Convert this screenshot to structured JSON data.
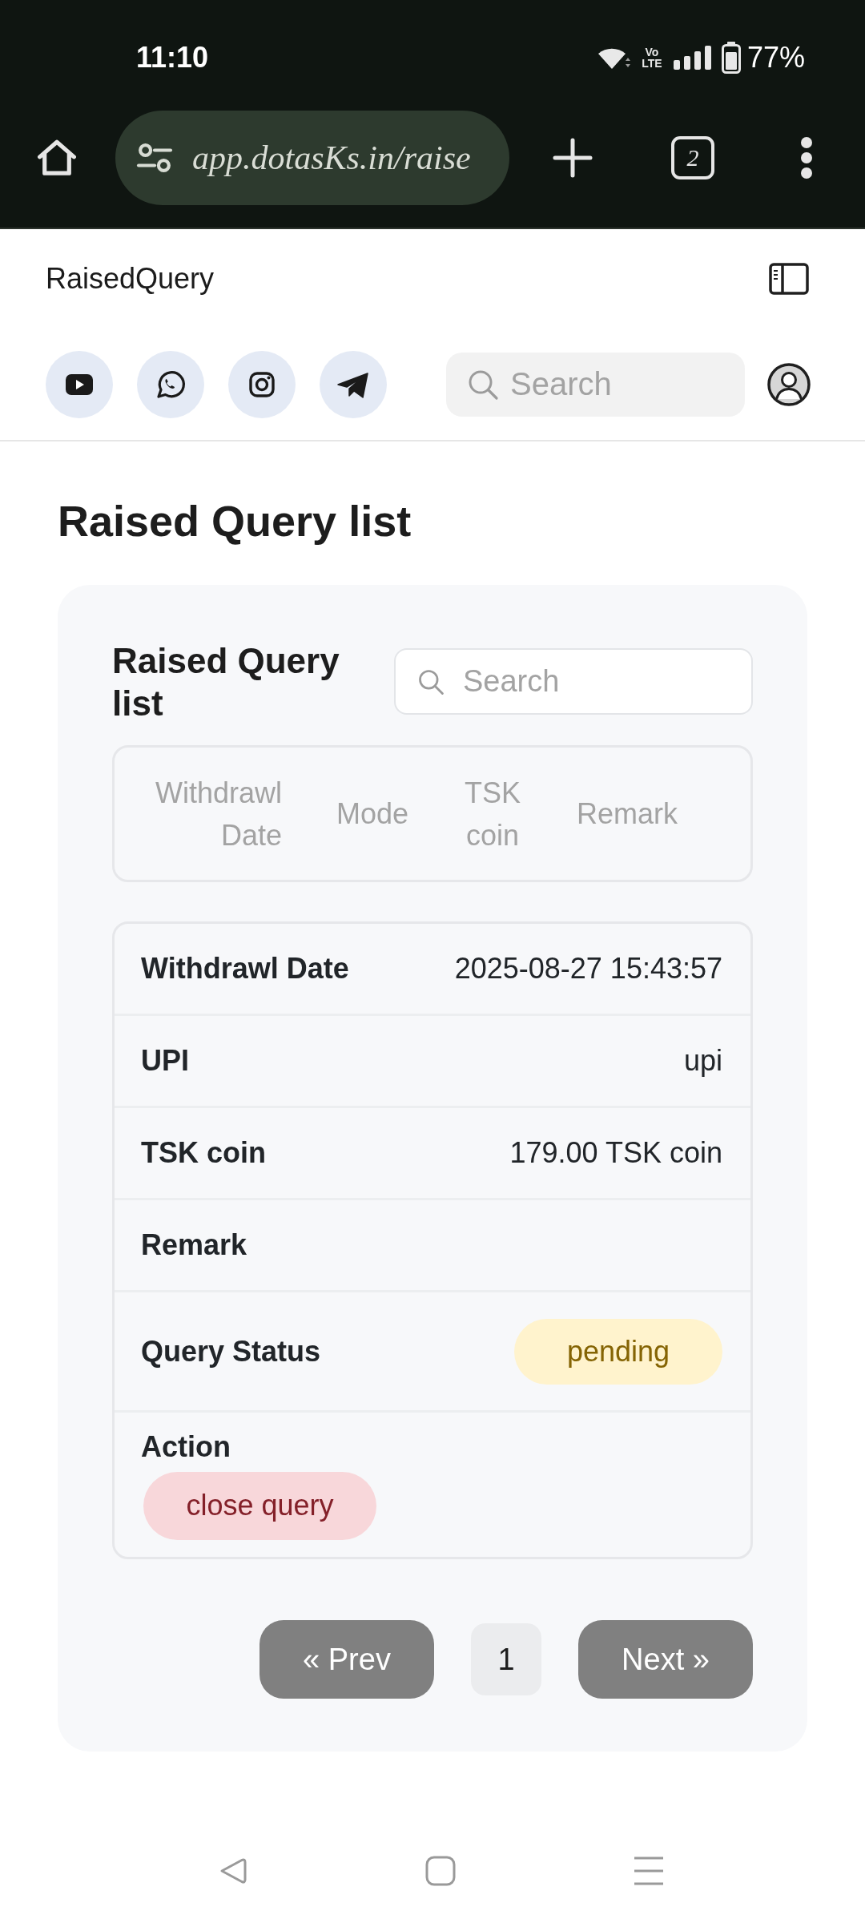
{
  "status_bar": {
    "time": "11:10",
    "network_type": "Vo LTE",
    "battery": "77%"
  },
  "browser": {
    "url": "app.dotasKs.in/raise",
    "tab_count": "2"
  },
  "header": {
    "title": "RaisedQuery"
  },
  "toolbar": {
    "social_links": [
      {
        "kind": "play"
      },
      {
        "kind": "chat"
      },
      {
        "kind": "camera"
      },
      {
        "kind": "plane"
      }
    ],
    "search": {
      "placeholder": "Search"
    }
  },
  "page": {
    "title": "Raised Query list"
  },
  "card": {
    "title": "Raised Query list",
    "search": {
      "placeholder": "Search"
    },
    "table": {
      "columns": [
        "Withdrawl Date",
        "Mode",
        "TSK coin",
        "Remark"
      ]
    },
    "details": [
      {
        "kind": "text",
        "label": "Withdrawl Date",
        "value": "2025-08-27 15:43:57"
      },
      {
        "kind": "text",
        "label": "UPI",
        "value": "upi"
      },
      {
        "kind": "text",
        "label": "TSK coin",
        "value": "179.00 TSK coin"
      },
      {
        "kind": "text",
        "label": "Remark"
      },
      {
        "kind": "badge",
        "label": "Query Status",
        "value": "pending"
      },
      {
        "kind": "button",
        "label": "Action",
        "value": "close query"
      }
    ]
  },
  "pagination": {
    "prev": "« Prev",
    "pages": [
      {
        "label": "1",
        "selected": true
      }
    ],
    "next": "Next »"
  }
}
